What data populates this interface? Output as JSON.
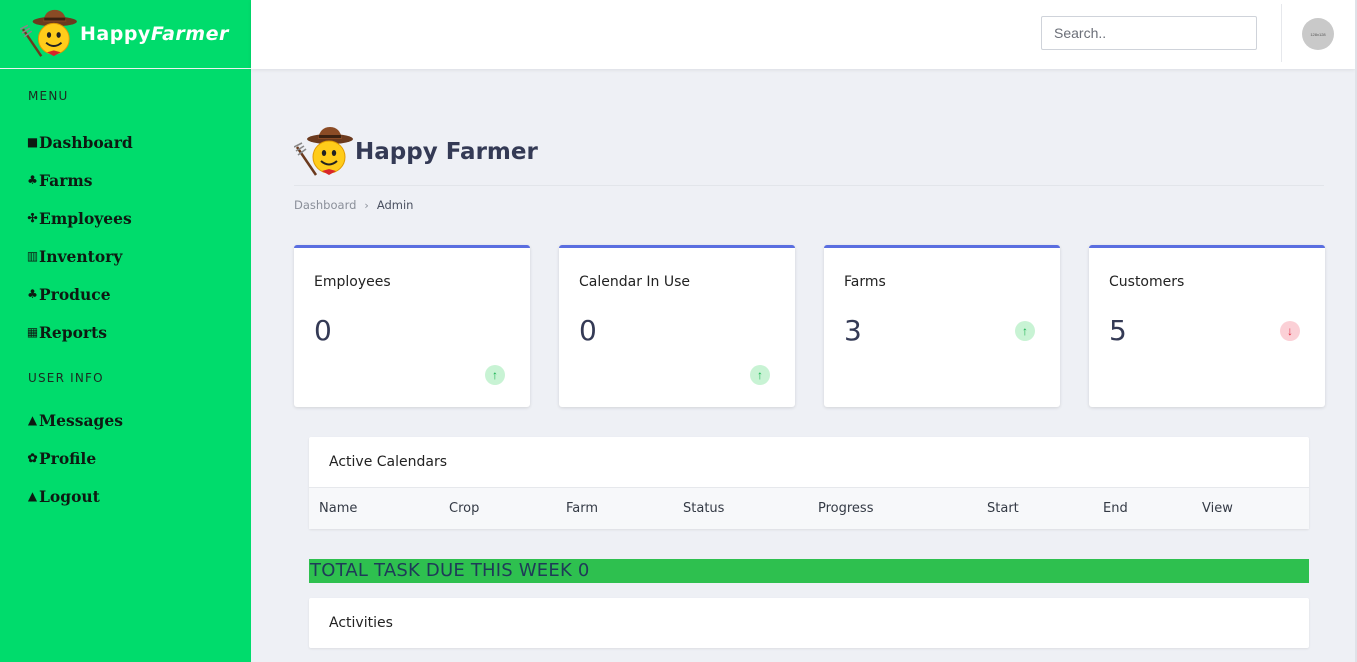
{
  "brand": {
    "name_part1": "Happy",
    "name_part2": "Farmer"
  },
  "sidebar": {
    "menu_heading": "MENU",
    "menu_items": [
      {
        "icon": "■",
        "label": "Dashboard"
      },
      {
        "icon": "♣",
        "label": "Farms"
      },
      {
        "icon": "✣",
        "label": "Employees"
      },
      {
        "icon": "▥",
        "label": "Inventory"
      },
      {
        "icon": "♣",
        "label": "Produce"
      },
      {
        "icon": "▦",
        "label": "Reports"
      }
    ],
    "user_heading": "USER INFO",
    "user_items": [
      {
        "icon": "▲",
        "label": "Messages"
      },
      {
        "icon": "✿",
        "label": "Profile"
      },
      {
        "icon": "▲",
        "label": "Logout"
      }
    ]
  },
  "topbar": {
    "search_placeholder": "Search..",
    "avatar_text": "128x128"
  },
  "page": {
    "title": "Happy Farmer",
    "breadcrumb": {
      "link": "Dashboard",
      "separator": "›",
      "current": "Admin"
    }
  },
  "cards": [
    {
      "label": "Employees",
      "value": "0",
      "trend": "up",
      "trend_icon": "↑"
    },
    {
      "label": "Calendar In Use",
      "value": "0",
      "trend": "up",
      "trend_icon": "↑"
    },
    {
      "label": "Farms",
      "value": "3",
      "trend": "up",
      "trend_icon": "↑"
    },
    {
      "label": "Customers",
      "value": "5",
      "trend": "down",
      "trend_icon": "↓"
    }
  ],
  "active_calendars": {
    "title": "Active Calendars",
    "columns": [
      "Name",
      "Crop",
      "Farm",
      "Status",
      "Progress",
      "Start",
      "End",
      "View"
    ]
  },
  "due_banner": "TOTAL TASK DUE THIS WEEK 0",
  "activities": {
    "title": "Activities"
  },
  "colors": {
    "sidebar": "#00dc6c",
    "card_accent": "#5a6ee0",
    "banner": "#2ec04f",
    "trend_up": "#10b14a",
    "trend_down": "#e0283f"
  }
}
